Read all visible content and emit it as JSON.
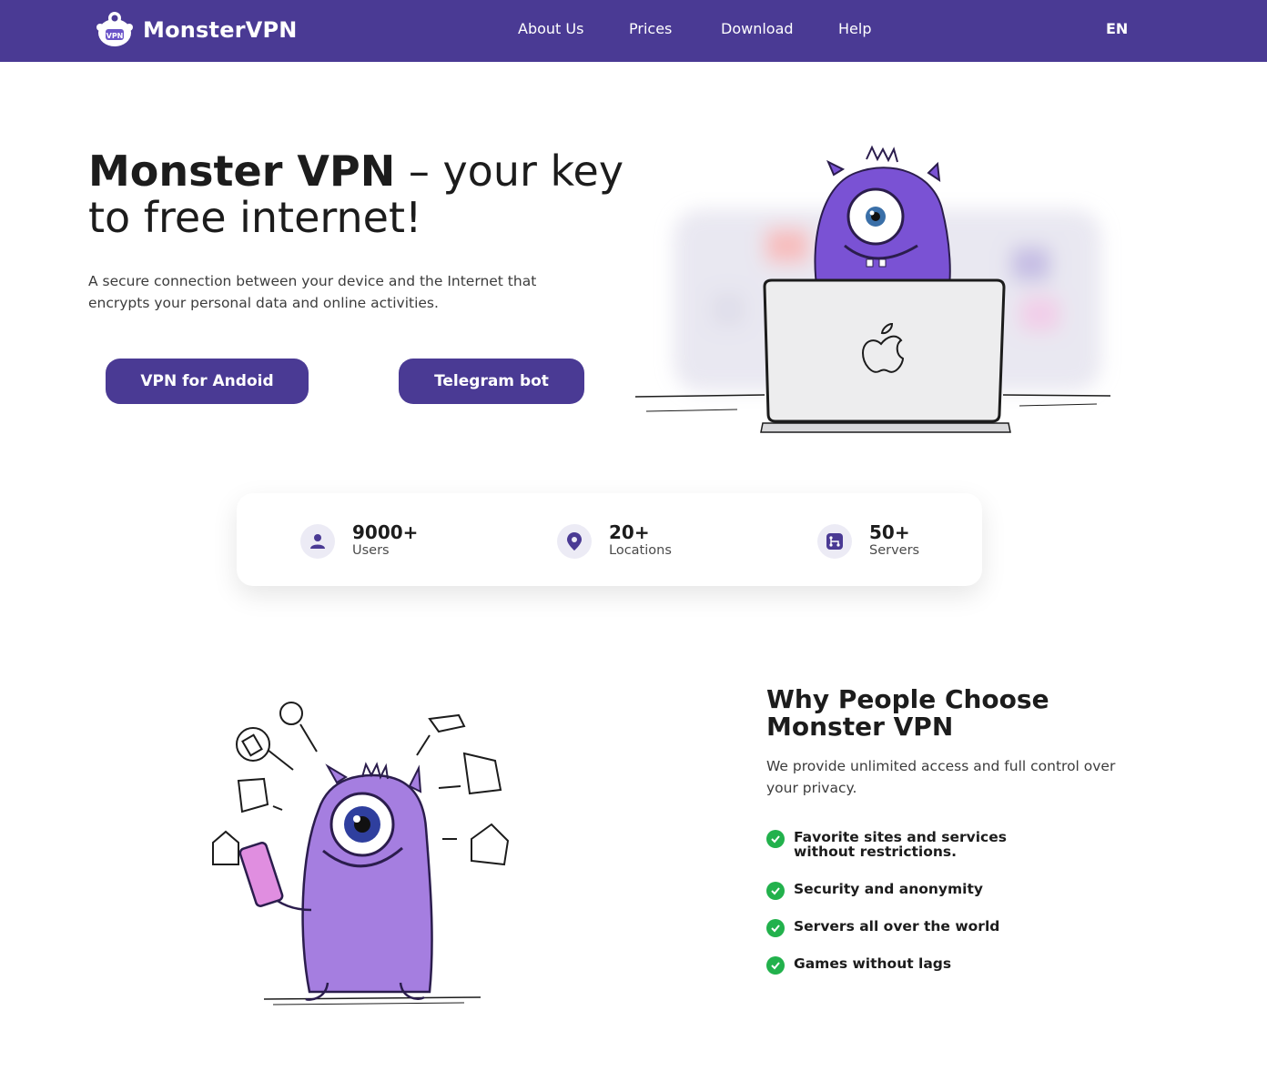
{
  "header": {
    "brand": "MonsterVPN",
    "nav": [
      {
        "label": "About Us"
      },
      {
        "label": "Prices"
      },
      {
        "label": "Download"
      },
      {
        "label": "Help"
      }
    ],
    "language": "EN"
  },
  "hero": {
    "title_bold": "Monster VPN",
    "title_rest": " – your key to free internet!",
    "description": "A secure connection between your device and the Internet that encrypts your personal data and online activities.",
    "buttons": {
      "android": "VPN for Andoid",
      "telegram": "Telegram bot"
    }
  },
  "stats": [
    {
      "value": "9000+",
      "label": "Users",
      "icon": "user-icon"
    },
    {
      "value": "20+",
      "label": "Locations",
      "icon": "location-pin-icon"
    },
    {
      "value": "50+",
      "label": "Servers",
      "icon": "server-network-icon"
    }
  ],
  "why": {
    "title": "Why People Choose Monster VPN",
    "description": "We provide unlimited access and full control over your privacy.",
    "features": [
      "Favorite sites and services without restrictions.",
      "Security and anonymity",
      "Servers all over the world",
      "Games without lags"
    ]
  },
  "colors": {
    "brand": "#4a3a94",
    "accent_purple": "#7b4fd6",
    "check_green": "#22b14c"
  }
}
